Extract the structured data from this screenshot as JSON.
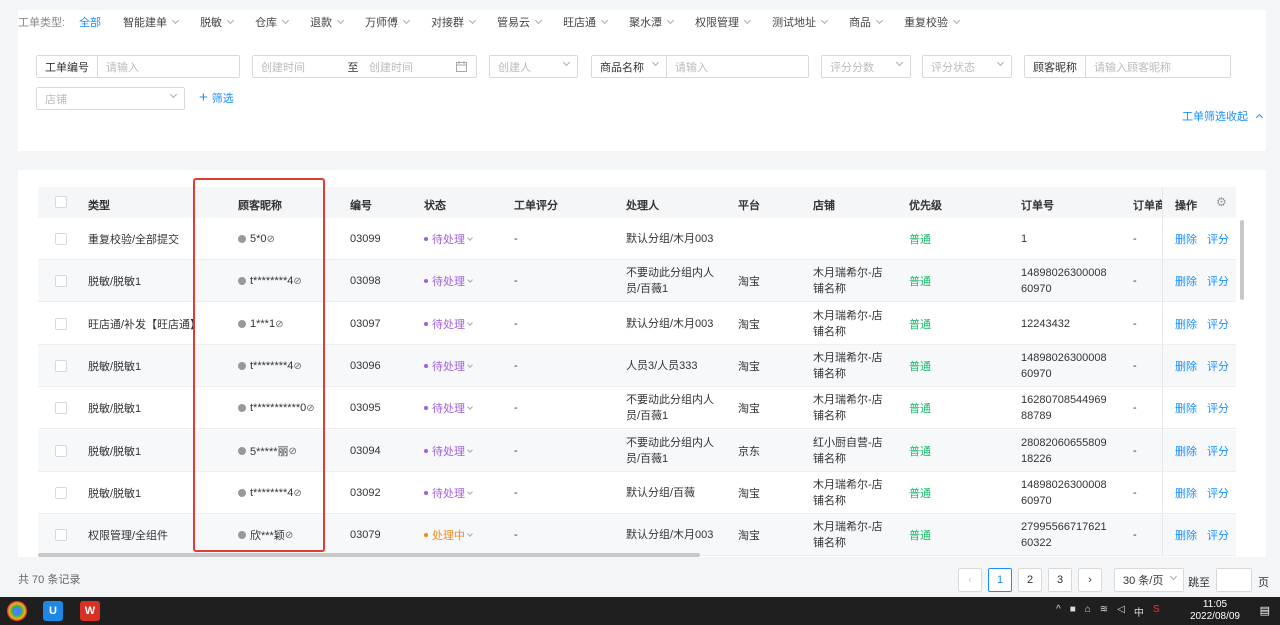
{
  "filters": {
    "type_label": "工单类型:",
    "tabs": [
      {
        "label": "全部",
        "active": true,
        "has_dropdown": false
      },
      {
        "label": "智能建单",
        "has_dropdown": true
      },
      {
        "label": "脱敏",
        "has_dropdown": true
      },
      {
        "label": "仓库",
        "has_dropdown": true
      },
      {
        "label": "退款",
        "has_dropdown": true
      },
      {
        "label": "万师傅",
        "has_dropdown": true
      },
      {
        "label": "对接群",
        "has_dropdown": true
      },
      {
        "label": "管易云",
        "has_dropdown": true
      },
      {
        "label": "旺店通",
        "has_dropdown": true
      },
      {
        "label": "聚水潭",
        "has_dropdown": true
      },
      {
        "label": "权限管理",
        "has_dropdown": true
      },
      {
        "label": "测试地址",
        "has_dropdown": true
      },
      {
        "label": "商品",
        "has_dropdown": true
      },
      {
        "label": "重复校验",
        "has_dropdown": true
      }
    ],
    "ticket_no_label": "工单编号",
    "ticket_no_placeholder": "请输入",
    "created_start_placeholder": "创建时间",
    "date_to": "至",
    "created_end_placeholder": "创建时间",
    "creator_placeholder": "创建人",
    "product_select": "商品名称",
    "product_placeholder": "请输入",
    "score_placeholder": "评分分数",
    "score_status_placeholder": "评分状态",
    "nickname_label": "顾客昵称",
    "nickname_placeholder": "请输入顾客昵称",
    "shop_placeholder": "店铺",
    "add_filter": "筛选",
    "collapse": "工单筛选收起"
  },
  "table": {
    "columns": [
      "类型",
      "顾客昵称",
      "编号",
      "状态",
      "工单评分",
      "处理人",
      "平台",
      "店铺",
      "优先级",
      "订单号",
      "订单商",
      "操作"
    ],
    "rows": [
      {
        "type": "重复校验/全部提交",
        "nick": "5*0",
        "id": "03099",
        "status": "待处理",
        "status_kind": "pending",
        "score": "-",
        "handler": "默认分组/木月003",
        "platform": "",
        "shop": "",
        "priority": "普通",
        "order": "1",
        "order_shop": "-"
      },
      {
        "type": "脱敏/脱敏1",
        "nick": "t********4",
        "id": "03098",
        "status": "待处理",
        "status_kind": "pending",
        "score": "-",
        "handler": "不要动此分组内人员/百薇1",
        "platform": "淘宝",
        "shop": "木月瑞希尔-店铺名称",
        "priority": "普通",
        "order": "1489802630000860970",
        "order_shop": "-"
      },
      {
        "type": "旺店通/补发【旺店通】",
        "nick": "1***1",
        "id": "03097",
        "status": "待处理",
        "status_kind": "pending",
        "score": "-",
        "handler": "默认分组/木月003",
        "platform": "淘宝",
        "shop": "木月瑞希尔-店铺名称",
        "priority": "普通",
        "order": "12243432",
        "order_shop": "-"
      },
      {
        "type": "脱敏/脱敏1",
        "nick": "t********4",
        "id": "03096",
        "status": "待处理",
        "status_kind": "pending",
        "score": "-",
        "handler": "人员3/人员333",
        "platform": "淘宝",
        "shop": "木月瑞希尔-店铺名称",
        "priority": "普通",
        "order": "1489802630000860970",
        "order_shop": "-"
      },
      {
        "type": "脱敏/脱敏1",
        "nick": "t***********0",
        "id": "03095",
        "status": "待处理",
        "status_kind": "pending",
        "score": "-",
        "handler": "不要动此分组内人员/百薇1",
        "platform": "淘宝",
        "shop": "木月瑞希尔-店铺名称",
        "priority": "普通",
        "order": "1628070854496988789",
        "order_shop": "-"
      },
      {
        "type": "脱敏/脱敏1",
        "nick": "5*****丽",
        "id": "03094",
        "status": "待处理",
        "status_kind": "pending",
        "score": "-",
        "handler": "不要动此分组内人员/百薇1",
        "platform": "京东",
        "shop": "红小厨自营-店铺名称",
        "priority": "普通",
        "order": "2808206065580918226",
        "order_shop": "-"
      },
      {
        "type": "脱敏/脱敏1",
        "nick": "t********4",
        "id": "03092",
        "status": "待处理",
        "status_kind": "pending",
        "score": "-",
        "handler": "默认分组/百薇",
        "platform": "淘宝",
        "shop": "木月瑞希尔-店铺名称",
        "priority": "普通",
        "order": "1489802630000860970",
        "order_shop": "-"
      },
      {
        "type": "权限管理/全组件",
        "nick": "欣***颖",
        "id": "03079",
        "status": "处理中",
        "status_kind": "processing",
        "score": "-",
        "handler": "默认分组/木月003",
        "platform": "淘宝",
        "shop": "木月瑞希尔-店铺名称",
        "priority": "普通",
        "order": "2799556671762160322",
        "order_shop": "-"
      }
    ],
    "op_delete": "删除",
    "op_score": "评分"
  },
  "footer": {
    "total": "共 70 条记录",
    "pages": [
      "1",
      "2",
      "3"
    ],
    "current_page": "1",
    "page_size": "30 条/页",
    "jump_label": "跳至",
    "page_unit": "页"
  },
  "taskbar": {
    "time": "11:05",
    "date": "2022/08/09",
    "tray_text": [
      "中"
    ]
  },
  "colors": {
    "accent": "#1890ff",
    "pending": "#a15fdc",
    "processing": "#f08a1c",
    "priority": "#19be6b",
    "highlight": "#e53935"
  }
}
